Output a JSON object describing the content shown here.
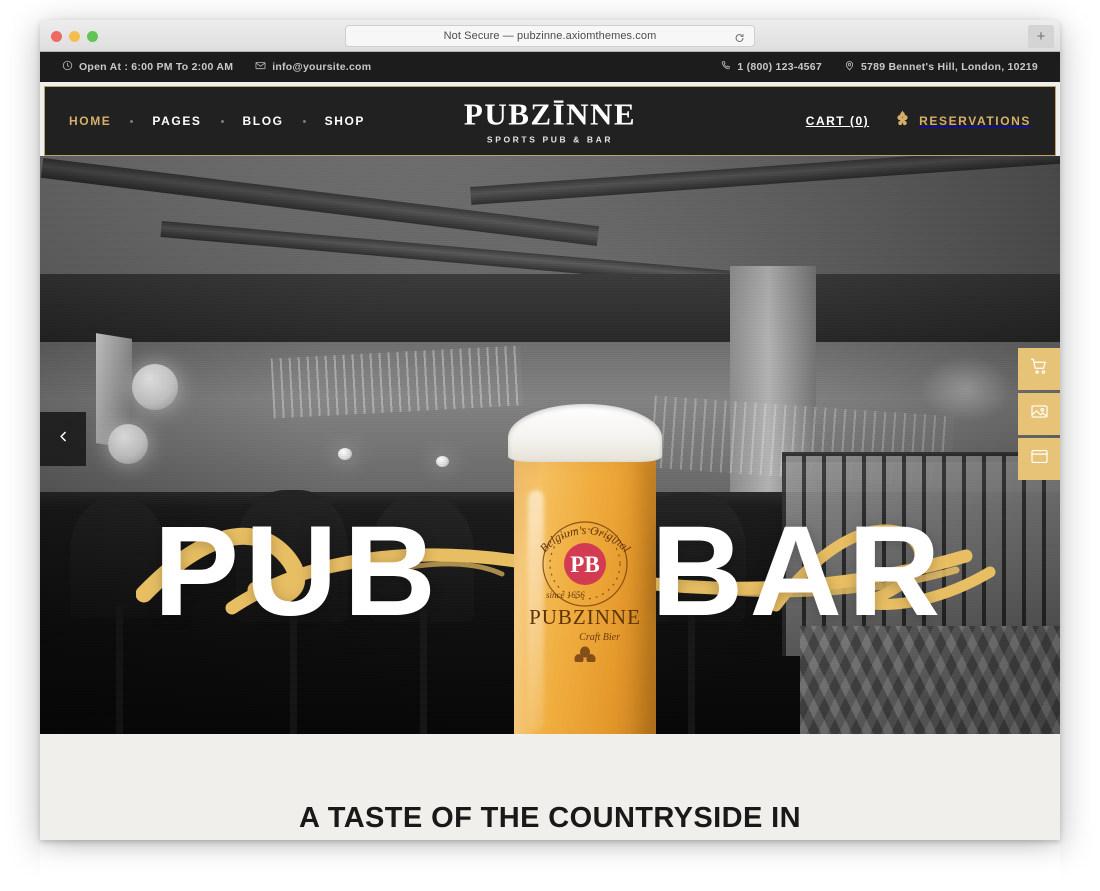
{
  "browser": {
    "url_text": "Not Secure — pubzinne.axiomthemes.com",
    "reload_icon": "reload-icon",
    "new_tab_label": "+",
    "traffic_lights": [
      "close",
      "minimize",
      "zoom"
    ]
  },
  "topbar": {
    "hours_icon": "clock-icon",
    "hours": "Open At : 6:00 PM To 2:00 AM",
    "email_icon": "envelope-icon",
    "email": "info@yoursite.com",
    "phone_icon": "phone-icon",
    "phone": "1 (800) 123-4567",
    "location_icon": "map-pin-icon",
    "address": "5789 Bennet's Hill, London, 10219"
  },
  "nav": {
    "items": [
      {
        "label": "HOME",
        "active": true
      },
      {
        "label": "PAGES",
        "active": false
      },
      {
        "label": "BLOG",
        "active": false
      },
      {
        "label": "SHOP",
        "active": false
      }
    ],
    "brand_name": "PUBZĪNNE",
    "brand_tagline": "SPORTS PUB & BAR",
    "cart_label": "CART (0)",
    "reservations_icon": "hop-cone-icon",
    "reservations_label": "RESERVATIONS",
    "border_color": "#c2a06a",
    "accent_color": "#d6af6c",
    "background_color": "#212121"
  },
  "hero": {
    "headline_left": "PUB",
    "headline_right": "BAR",
    "script_word": "Craft Beer Welcome",
    "prev_icon": "chevron-left-icon",
    "glass_label": {
      "top_arc": "Belgium's Original",
      "monogram": "PB",
      "since": "since 1656",
      "brand": "PUBZINNE",
      "sub": "Craft Bier"
    },
    "side_buttons": [
      {
        "icon": "shopping-cart-icon",
        "name": "cart"
      },
      {
        "icon": "image-gallery-icon",
        "name": "gallery"
      },
      {
        "icon": "window-layout-icon",
        "name": "layout"
      }
    ],
    "accent_color": "#e6c377",
    "script_color": "#e8be63"
  },
  "section": {
    "title": "A TASTE OF THE COUNTRYSIDE IN"
  }
}
